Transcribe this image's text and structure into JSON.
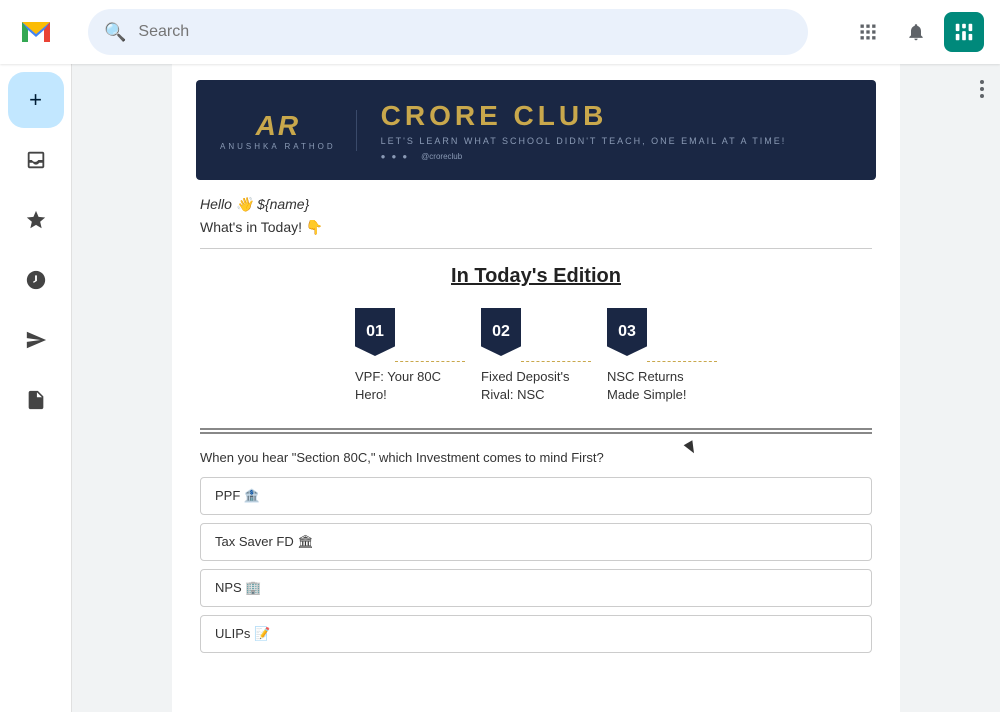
{
  "topbar": {
    "search_placeholder": "Search"
  },
  "sidebar": {
    "compose_icon": "+",
    "items": [
      {
        "name": "inbox",
        "icon": "☰"
      },
      {
        "name": "starred",
        "icon": "☆"
      },
      {
        "name": "snoozed",
        "icon": "🕐"
      },
      {
        "name": "sent",
        "icon": "➤"
      },
      {
        "name": "drafts",
        "icon": "📄"
      }
    ]
  },
  "email": {
    "banner": {
      "logo_text": "AR",
      "logo_name": "ANUSHKA RATHOD",
      "title": "CRORE CLUB",
      "subtitle": "LET'S LEARN WHAT SCHOOL DIDN'T TEACH, ONE EMAIL AT A TIME!"
    },
    "greeting": "Hello 👋 ${name}",
    "whats_in": "What's in Today! 👇",
    "edition_title": "In Today's Edition",
    "edition_items": [
      {
        "number": "01",
        "title": "VPF: Your 80C Hero!"
      },
      {
        "number": "02",
        "title": "Fixed Deposit's Rival: NSC"
      },
      {
        "number": "03",
        "title": "NSC Returns Made Simple!"
      }
    ],
    "poll": {
      "question": "When you hear \"Section 80C,\" which Investment comes to mind First?",
      "options": [
        "PPF 🏦",
        "Tax Saver FD 🏛",
        "NPS 🏢",
        "ULIPs 📝"
      ]
    }
  }
}
